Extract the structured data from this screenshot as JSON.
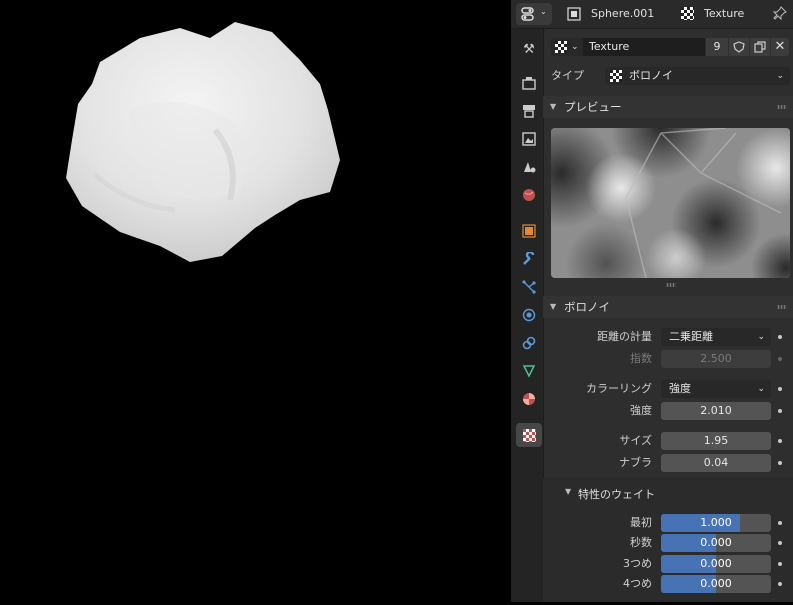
{
  "header": {
    "object_name": "Sphere.001",
    "texture_name": "Texture"
  },
  "datablock": {
    "name": "Texture",
    "users": "9"
  },
  "type": {
    "label": "タイプ",
    "value": "ボロノイ"
  },
  "preview": {
    "title": "プレビュー"
  },
  "voronoi": {
    "title": "ボロノイ",
    "distance_metric": {
      "label": "距離の計量",
      "value": "二乗距離"
    },
    "exponent": {
      "label": "指数",
      "value": "2.500"
    },
    "coloring": {
      "label": "カラーリング",
      "value": "強度"
    },
    "intensity": {
      "label": "強度",
      "value": "2.010"
    },
    "size": {
      "label": "サイズ",
      "value": "1.95"
    },
    "nabla": {
      "label": "ナブラ",
      "value": "0.04"
    }
  },
  "feature_weights": {
    "title": "特性のウェイト",
    "items": [
      {
        "label": "最初",
        "value": "1.000",
        "fill": 0.72
      },
      {
        "label": "秒数",
        "value": "0.000",
        "fill": 0.5
      },
      {
        "label": "3つめ",
        "value": "0.000",
        "fill": 0.5
      },
      {
        "label": "4つめ",
        "value": "0.000",
        "fill": 0.5
      }
    ]
  },
  "colors": {
    "accent": "#4772b3",
    "panel": "#2e2e2e",
    "viewport": "#000000"
  },
  "icons": [
    "properties-editor-icon",
    "object-icon",
    "texture-icon",
    "pin-icon",
    "tool-icon",
    "render-icon",
    "output-icon",
    "view-layer-icon",
    "scene-icon",
    "world-icon",
    "object-props-icon",
    "modifier-icon",
    "particles-icon",
    "physics-icon",
    "constraints-icon",
    "data-icon",
    "material-icon",
    "texture-props-icon"
  ]
}
